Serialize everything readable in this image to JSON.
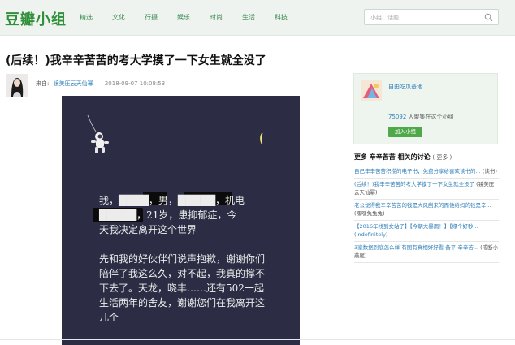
{
  "header": {
    "logo": "豆瓣小组",
    "nav": [
      "精选",
      "文化",
      "行摄",
      "娱乐",
      "时尚",
      "生活",
      "科技"
    ],
    "search_placeholder": "小组、话题"
  },
  "post": {
    "title": "(后续！)我辛辛苦苦的考大学摸了一下女生就全没了",
    "from_label": "来自:",
    "author": "镜美压云天仙幂",
    "time": "2018-09-07 10:08:53"
  },
  "image_text": {
    "line1": "我，████，男，█████，机电",
    "line2": "█████，21岁，患抑郁症，今",
    "line3": "天我决定离开这个世界",
    "para2": "先和我的好伙伴们说声抱歉，谢谢你们陪伴了我这么久，对不起，我真的撑不下去了。天龙，晓丰……还有502一起生活两年的舍友，谢谢您们在我离开这儿个"
  },
  "sidebar": {
    "group_name": "自由吃瓜基地",
    "member_count": "75092",
    "member_suffix": "人聚集在这个小组",
    "join_label": "加入小组",
    "related_title": "更多 辛辛苦苦 相关的讨论",
    "related_more": "( 更多 )",
    "related_items": [
      {
        "text": "自己辛辛苦苦积攒的电子书，免费分享给喜欢读书的...",
        "group": "(读书)"
      },
      {
        "text": "(后续！)我辛辛苦苦的考大学摸了一下女生就全没了",
        "group": "(镜美压云天仙幂)"
      },
      {
        "text": "老公觉得我辛辛苦苦的钱是大风刮来的而他给妈的钱是辛...",
        "group": "(嘿嘿兔兔兔)"
      },
      {
        "text": "【2016年找到女站子】【今朝大暴雨！】【缘个好秒... (Indefinitely)",
        "group": ""
      },
      {
        "text": "3家数据到底怎么样 有图有真相好好看 备平 辛辛苦...",
        "group": "(戒断小燕尾)"
      }
    ]
  },
  "colors": {
    "brand_green": "#2f8f3a",
    "link_blue": "#2f7fb8",
    "image_bg": "#2c2d44",
    "join_green": "#4fa84a"
  }
}
